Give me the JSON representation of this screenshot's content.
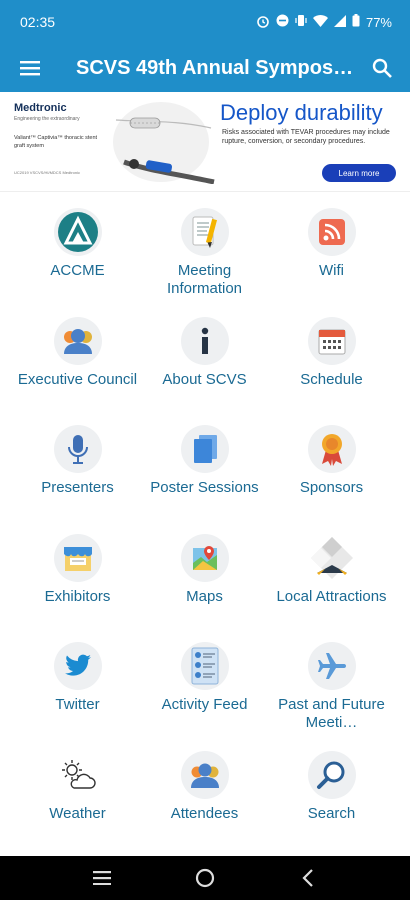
{
  "status": {
    "time": "02:35",
    "battery": "77%"
  },
  "app_bar": {
    "title": "SCVS 49th Annual Symposi…"
  },
  "ad": {
    "brand": "Medtronic",
    "tagline": "Engineering the extraordinary",
    "product": "Valiant™ Captivia™ thoracic stent graft system",
    "footnote": "UC2019 VSCVS/HI/MDCS Medtronic",
    "headline": "Deploy durability",
    "risk": "Risks associated with TEVAR procedures may include rupture, conversion, or secondary procedures.",
    "cta": "Learn more"
  },
  "tiles": [
    {
      "label": "ACCME",
      "icon": "accme-logo-icon"
    },
    {
      "label": "Meeting Information",
      "icon": "document-pencil-icon"
    },
    {
      "label": "Wifi",
      "icon": "wifi-icon"
    },
    {
      "label": "Executive Council",
      "icon": "people-group-icon"
    },
    {
      "label": "About SCVS",
      "icon": "info-icon"
    },
    {
      "label": "Schedule",
      "icon": "calendar-icon"
    },
    {
      "label": "Presenters",
      "icon": "microphone-icon"
    },
    {
      "label": "Poster Sessions",
      "icon": "documents-icon"
    },
    {
      "label": "Sponsors",
      "icon": "award-ribbon-icon"
    },
    {
      "label": "Exhibitors",
      "icon": "booth-icon"
    },
    {
      "label": "Maps",
      "icon": "map-icon"
    },
    {
      "label": "Local Attractions",
      "icon": "attractions-icon"
    },
    {
      "label": "Twitter",
      "icon": "twitter-bird-icon"
    },
    {
      "label": "Activity Feed",
      "icon": "activity-feed-icon"
    },
    {
      "label": "Past and Future Meeti…",
      "icon": "airplane-icon"
    },
    {
      "label": "Weather",
      "icon": "weather-icon"
    },
    {
      "label": "Attendees",
      "icon": "attendees-icon"
    },
    {
      "label": "Search",
      "icon": "magnifier-icon"
    }
  ],
  "colors": {
    "primary": "#1f8ec9",
    "label": "#1b6a93",
    "ad_blue": "#1556c8"
  }
}
